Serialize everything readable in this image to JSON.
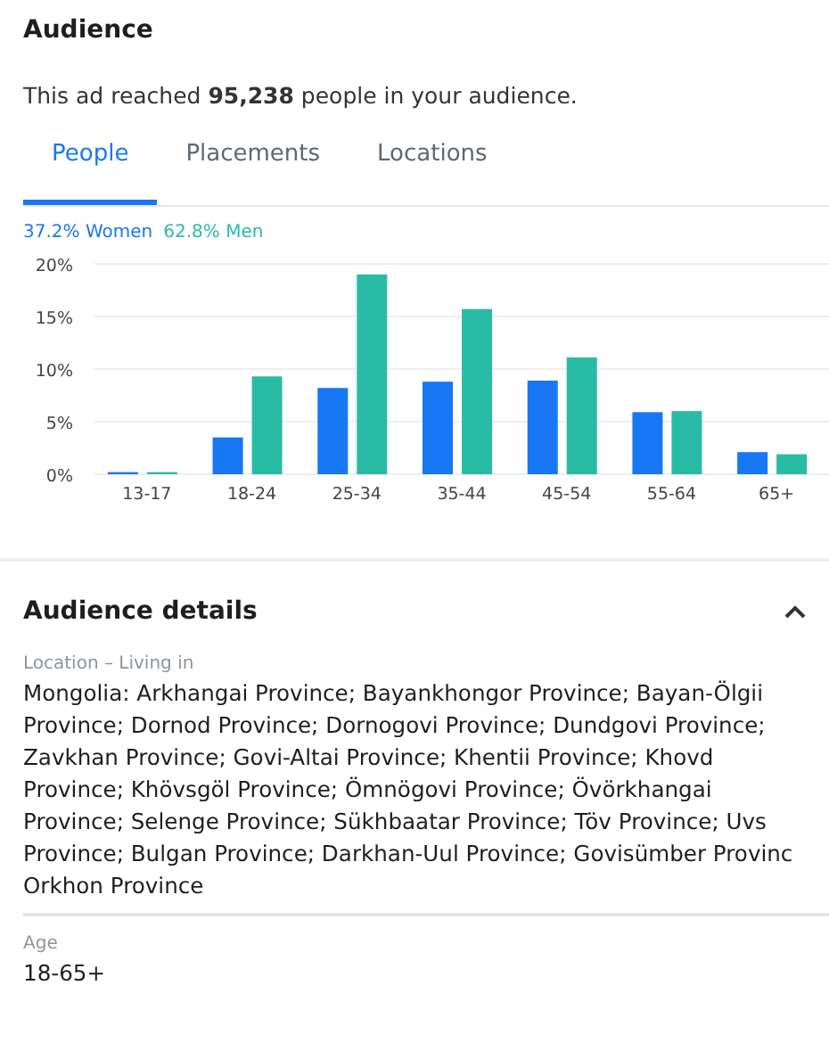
{
  "title": "Audience",
  "summary": "This ad reached **95,238** people in your audience.",
  "tabs": [
    {
      "label": "People",
      "selected": true
    },
    {
      "label": "Placements",
      "selected": false
    },
    {
      "label": "Locations",
      "selected": false
    }
  ],
  "legend_shares": [
    "37.2%",
    "62.8%"
  ],
  "chart_data": {
    "type": "bar",
    "grid": true,
    "categories": [
      "13-17",
      "18-24",
      "25-34",
      "35-44",
      "45-54",
      "55-64",
      "65+"
    ],
    "series": [
      {
        "name": "Women",
        "color": "#1877f2",
        "values": [
          0.2,
          3.5,
          8.2,
          8.8,
          8.9,
          5.9,
          2.1
        ]
      },
      {
        "name": "Men",
        "color": "#2abba7",
        "values": [
          0.2,
          9.3,
          19,
          15.7,
          11.1,
          6,
          1.9
        ]
      }
    ],
    "ylim": [
      0,
      20
    ],
    "yticks": [
      {
        "value": 0,
        "label": "0%"
      },
      {
        "value": 5,
        "label": "5%"
      },
      {
        "value": 10,
        "label": "10%"
      },
      {
        "value": 15,
        "label": "15%"
      },
      {
        "value": 20,
        "label": "20%"
      }
    ]
  },
  "details": {
    "title": "Audience details",
    "expanded": true,
    "fields": [
      {
        "label": "Location – Living in",
        "lines": [
          "Mongolia: Arkhangai Province; Bayankhongor Province; Bayan-Ölgii",
          "Province; Dornod Province; Dornogovi Province; Dundgovi Province;",
          "Zavkhan Province; Govi-Altai Province; Khentii Province; Khovd",
          "Province; Khövsgöl Province; Ömnögovi Province; Övörkhangai",
          "Province; Selenge Province; Sükhbaatar Province; Töv Province; Uvs",
          "Province; Bulgan Province; Darkhan-Uul Province; Govisümber Provinc",
          "Orkhon Province"
        ]
      },
      {
        "label": "Age",
        "lines": [
          "18-65+"
        ]
      }
    ]
  }
}
